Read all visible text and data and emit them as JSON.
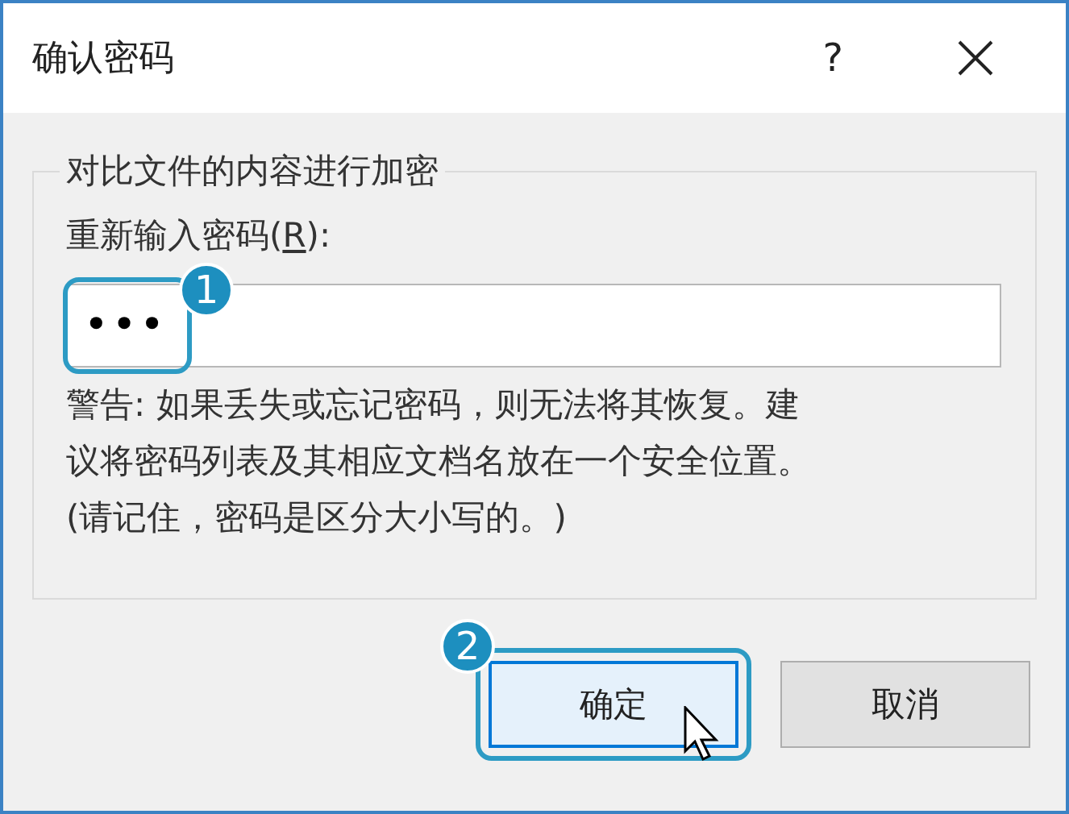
{
  "window": {
    "title": "确认密码",
    "help": "?"
  },
  "group": {
    "title": "对比文件的内容进行加密",
    "field_label": {
      "before": "重新输入密码(",
      "access_key": "R",
      "after": "):"
    },
    "password": {
      "value": "•••",
      "callout": "1"
    },
    "warning_lines": [
      "警告: 如果丢失或忘记密码，则无法将其恢复。建",
      "议将密码列表及其相应文档名放在一个安全位置。",
      "(请记住，密码是区分大小写的。)"
    ]
  },
  "buttons": [
    {
      "label": "确定",
      "kind": "default",
      "hovered": true,
      "callout": "2"
    },
    {
      "label": "取消",
      "kind": "normal",
      "hovered": false
    }
  ]
}
